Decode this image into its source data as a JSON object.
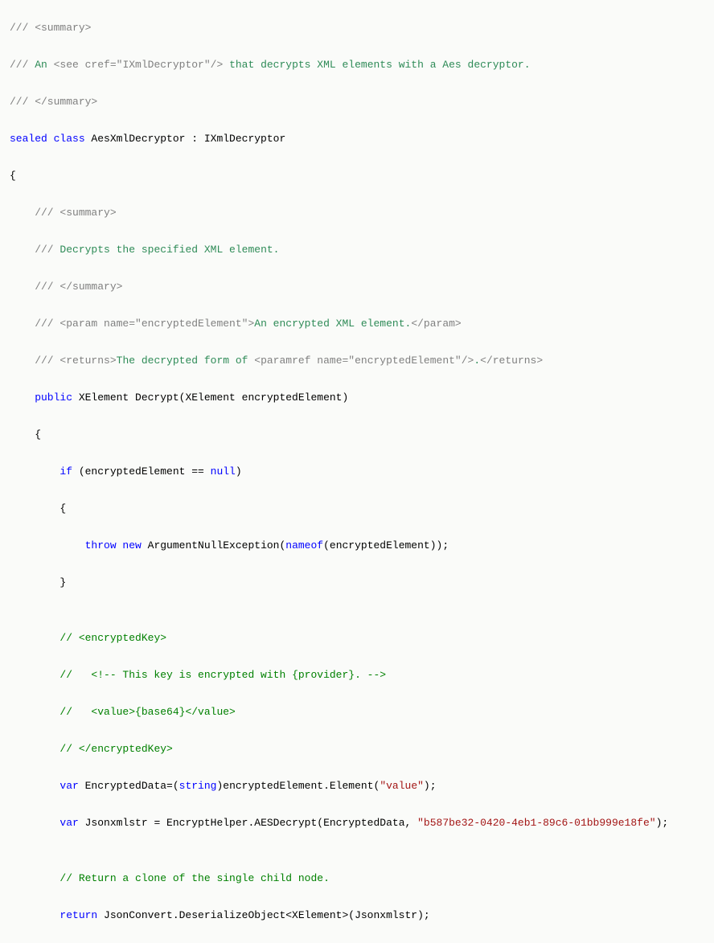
{
  "code": {
    "l01_a": "/// <summary>",
    "l02_a": "/// ",
    "l02_b": "An ",
    "l02_c": "<see cref=\"IXmlDecryptor\"/>",
    "l02_d": " that decrypts XML elements with a Aes decryptor.",
    "l03_a": "/// </summary>",
    "l04_a": "sealed",
    "l04_b": " class",
    "l04_c": " AesXmlDecryptor : IXmlDecryptor",
    "l05_a": "{",
    "l06_a": "    /// ",
    "l06_b": "<summary>",
    "l07_a": "    /// ",
    "l07_b": "Decrypts the specified XML element.",
    "l08_a": "    /// ",
    "l08_b": "</summary>",
    "l09_a": "    /// ",
    "l09_b": "<param name=\"encryptedElement\">",
    "l09_c": "An encrypted XML element.",
    "l09_d": "</param>",
    "l10_a": "    /// ",
    "l10_b": "<returns>",
    "l10_c": "The decrypted form of ",
    "l10_d": "<paramref name=\"encryptedElement\"/>",
    "l10_e": ".",
    "l10_f": "</returns>",
    "l11_a": "    public",
    "l11_b": " XElement Decrypt(XElement encryptedElement)",
    "l12_a": "    {",
    "l13_a": "        if",
    "l13_b": " (encryptedElement == ",
    "l13_c": "null",
    "l13_d": ")",
    "l14_a": "        {",
    "l15_a": "            throw",
    "l15_b": " new",
    "l15_c": " ArgumentNullException(",
    "l15_d": "nameof",
    "l15_e": "(encryptedElement));",
    "l16_a": "        }",
    "l17_a": "",
    "l18_a": "        // ",
    "l18_b": "<encryptedKey>",
    "l19_a": "        //   ",
    "l19_b": "<!-- This key is encrypted with {provider}. -->",
    "l20_a": "        //   ",
    "l20_b": "<value>{base64}</value>",
    "l21_a": "        // ",
    "l21_b": "</encryptedKey>",
    "l22_a": "        var",
    "l22_b": " EncryptedData=(",
    "l22_c": "string",
    "l22_d": ")encryptedElement.Element(",
    "l22_e": "\"value\"",
    "l22_f": ");",
    "l23_a": "        var",
    "l23_b": " Jsonxmlstr = EncryptHelper.AESDecrypt(EncryptedData, ",
    "l23_c": "\"b587be32-0420-4eb1-89c6-01bb999e18fe\"",
    "l23_d": ");",
    "l24_a": "",
    "l25_a": "        // Return a clone of the single child node.",
    "l26_a": "        return",
    "l26_b": " JsonConvert.DeserializeObject<XElement>(Jsonxmlstr);"
  }
}
